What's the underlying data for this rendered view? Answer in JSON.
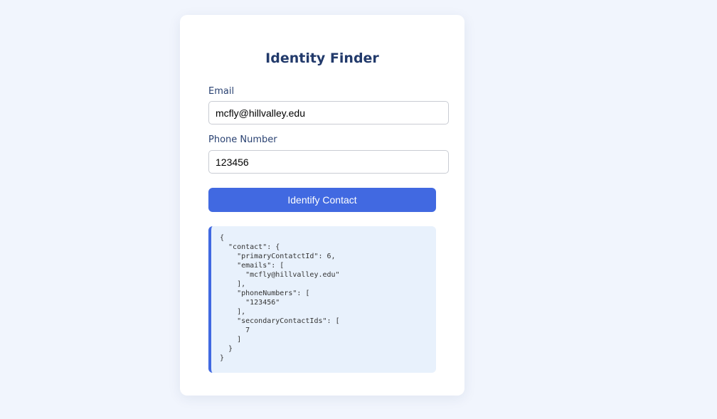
{
  "form": {
    "title": "Identity Finder",
    "email_label": "Email",
    "email_value": "mcfly@hillvalley.edu",
    "phone_label": "Phone Number",
    "phone_value": "123456",
    "submit_label": "Identify Contact"
  },
  "result": {
    "json_text": "{\n  \"contact\": {\n    \"primaryContatctId\": 6,\n    \"emails\": [\n      \"mcfly@hillvalley.edu\"\n    ],\n    \"phoneNumbers\": [\n      \"123456\"\n    ],\n    \"secondaryContactIds\": [\n      7\n    ]\n  }\n}"
  },
  "colors": {
    "page_background": "#f1f5fd",
    "accent": "#4169e1",
    "title": "#223a6b",
    "result_background": "#e8f1fc"
  }
}
